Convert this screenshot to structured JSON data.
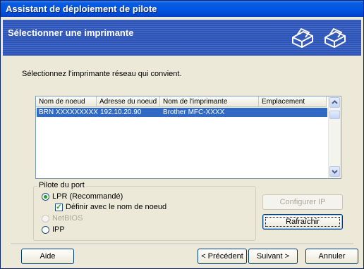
{
  "window": {
    "title": "Assistant de déploiement de pilote"
  },
  "banner": {
    "title": "Sélectionner une imprimante",
    "icons": [
      "printer-icon",
      "printer-icon"
    ]
  },
  "instruction": "Sélectionnez l'imprimante réseau qui convient.",
  "printer_list": {
    "columns": [
      "Nom de noeud",
      "Adresse du noeud",
      "Nom de l'imprimante",
      "Emplacement"
    ],
    "rows": [
      {
        "node_name": "BRN XXXXXXXXX",
        "node_address": "192.10.20.90",
        "printer_name": "Brother    MFC-XXXX",
        "location": ""
      }
    ],
    "selected_row": 0
  },
  "port_driver": {
    "label": "Pilote du port",
    "lpr_label": "LPR (Recommandé)",
    "lpr_selected": true,
    "define_node_label": "Définir avec le nom de noeud",
    "define_node_checked": true,
    "netbios_label": "NetBIOS",
    "netbios_enabled": false,
    "ipp_label": "IPP"
  },
  "buttons": {
    "configure_ip": "Configurer IP",
    "refresh": "Rafraîchir",
    "help": "Aide",
    "previous": "< Précédent",
    "next": "Suivant >",
    "cancel": "Annuler"
  },
  "colors": {
    "title_bar": "#0054e3",
    "banner": "#2d54b8",
    "selection": "#316ac5",
    "dialog_bg": "#ece9d8"
  }
}
